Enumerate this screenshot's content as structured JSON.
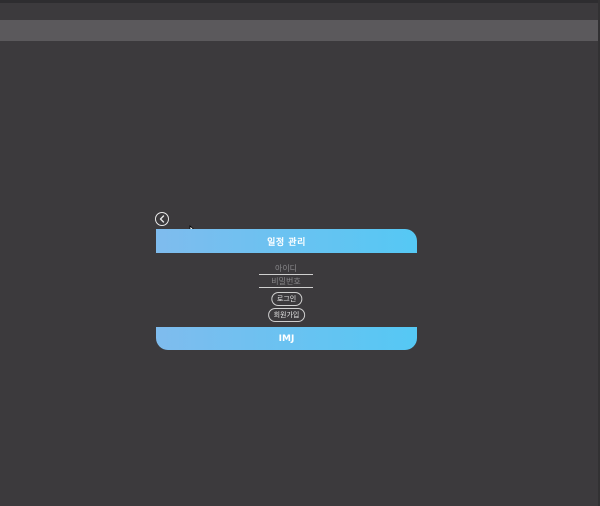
{
  "header": {
    "title": "일정 관리"
  },
  "form": {
    "id_placeholder": "아이디",
    "password_placeholder": "비밀번호",
    "login_label": "로그인",
    "signup_label": "회원가입"
  },
  "footer": {
    "label": "IMJ"
  },
  "icons": {
    "back": "back-arrow-icon",
    "cursor": "mouse-cursor-icon"
  },
  "colors": {
    "background": "#3c3a3d",
    "accent_start": "#7fbcee",
    "accent_end": "#55c8f4"
  }
}
